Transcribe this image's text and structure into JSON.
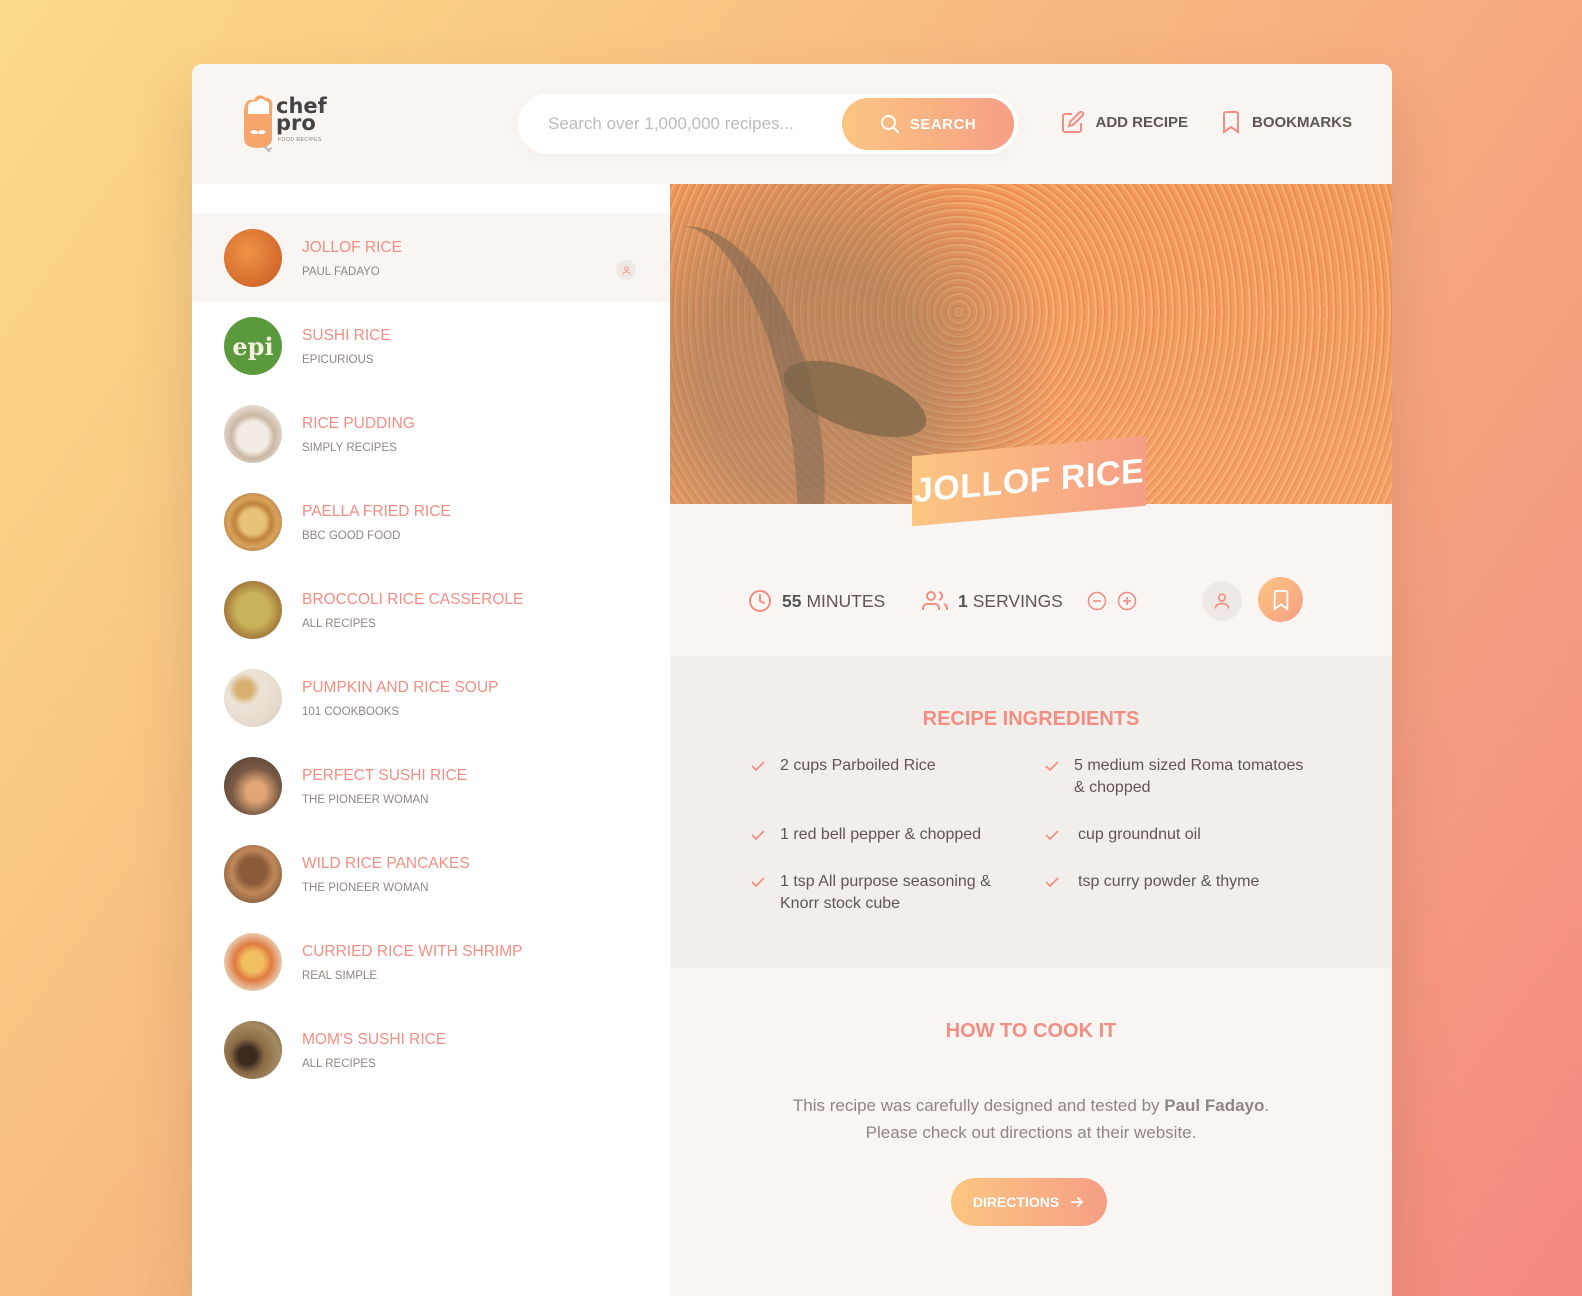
{
  "header": {
    "logo_line1": "chef",
    "logo_line2": "pro",
    "logo_sub": "FOOD RECIPES",
    "search_placeholder": "Search over 1,000,000 recipes...",
    "search_button": "SEARCH",
    "add_recipe": "ADD RECIPE",
    "bookmarks": "BOOKMARKS"
  },
  "sidebar": {
    "items": [
      {
        "title": "JOLLOF RICE",
        "publisher": "PAUL FADAYO",
        "active": true
      },
      {
        "title": "SUSHI RICE",
        "publisher": "EPICURIOUS"
      },
      {
        "title": "RICE PUDDING",
        "publisher": "SIMPLY RECIPES"
      },
      {
        "title": "PAELLA FRIED RICE",
        "publisher": "BBC GOOD FOOD"
      },
      {
        "title": "BROCCOLI RICE CASSEROLE",
        "publisher": "ALL RECIPES"
      },
      {
        "title": "PUMPKIN AND RICE SOUP",
        "publisher": "101 COOKBOOKS"
      },
      {
        "title": "PERFECT SUSHI RICE",
        "publisher": "THE PIONEER WOMAN"
      },
      {
        "title": "WILD RICE PANCAKES",
        "publisher": "THE PIONEER WOMAN"
      },
      {
        "title": "CURRIED RICE WITH SHRIMP",
        "publisher": "REAL SIMPLE"
      },
      {
        "title": "MOM'S SUSHI RICE",
        "publisher": "ALL RECIPES"
      }
    ],
    "epi_logo_text": "epi"
  },
  "recipe": {
    "title": "JOLLOF RICE",
    "minutes": "55",
    "minutes_label": "MINUTES",
    "servings": "1",
    "servings_label": "SERVINGS",
    "ingredients_title": "RECIPE INGREDIENTS",
    "ingredients": [
      "2 cups Parboiled Rice",
      "5 medium sized Roma tomatoes & chopped",
      "1 red bell pepper & chopped",
      "cup groundnut oil",
      "1 tsp All purpose seasoning & Knorr stock cube",
      "tsp curry powder & thyme"
    ],
    "cook_title": "HOW TO COOK IT",
    "cook_text_1": "This recipe was carefully designed and tested by ",
    "cook_author": "Paul Fadayo",
    "cook_text_2": ".",
    "cook_text_3": "Please check out directions at their website.",
    "directions_button": "DIRECTIONS"
  },
  "colors": {
    "accent": "#f38e82",
    "gradient_start": "#fbc681",
    "gradient_end": "#f69e85",
    "text": "#615551"
  }
}
